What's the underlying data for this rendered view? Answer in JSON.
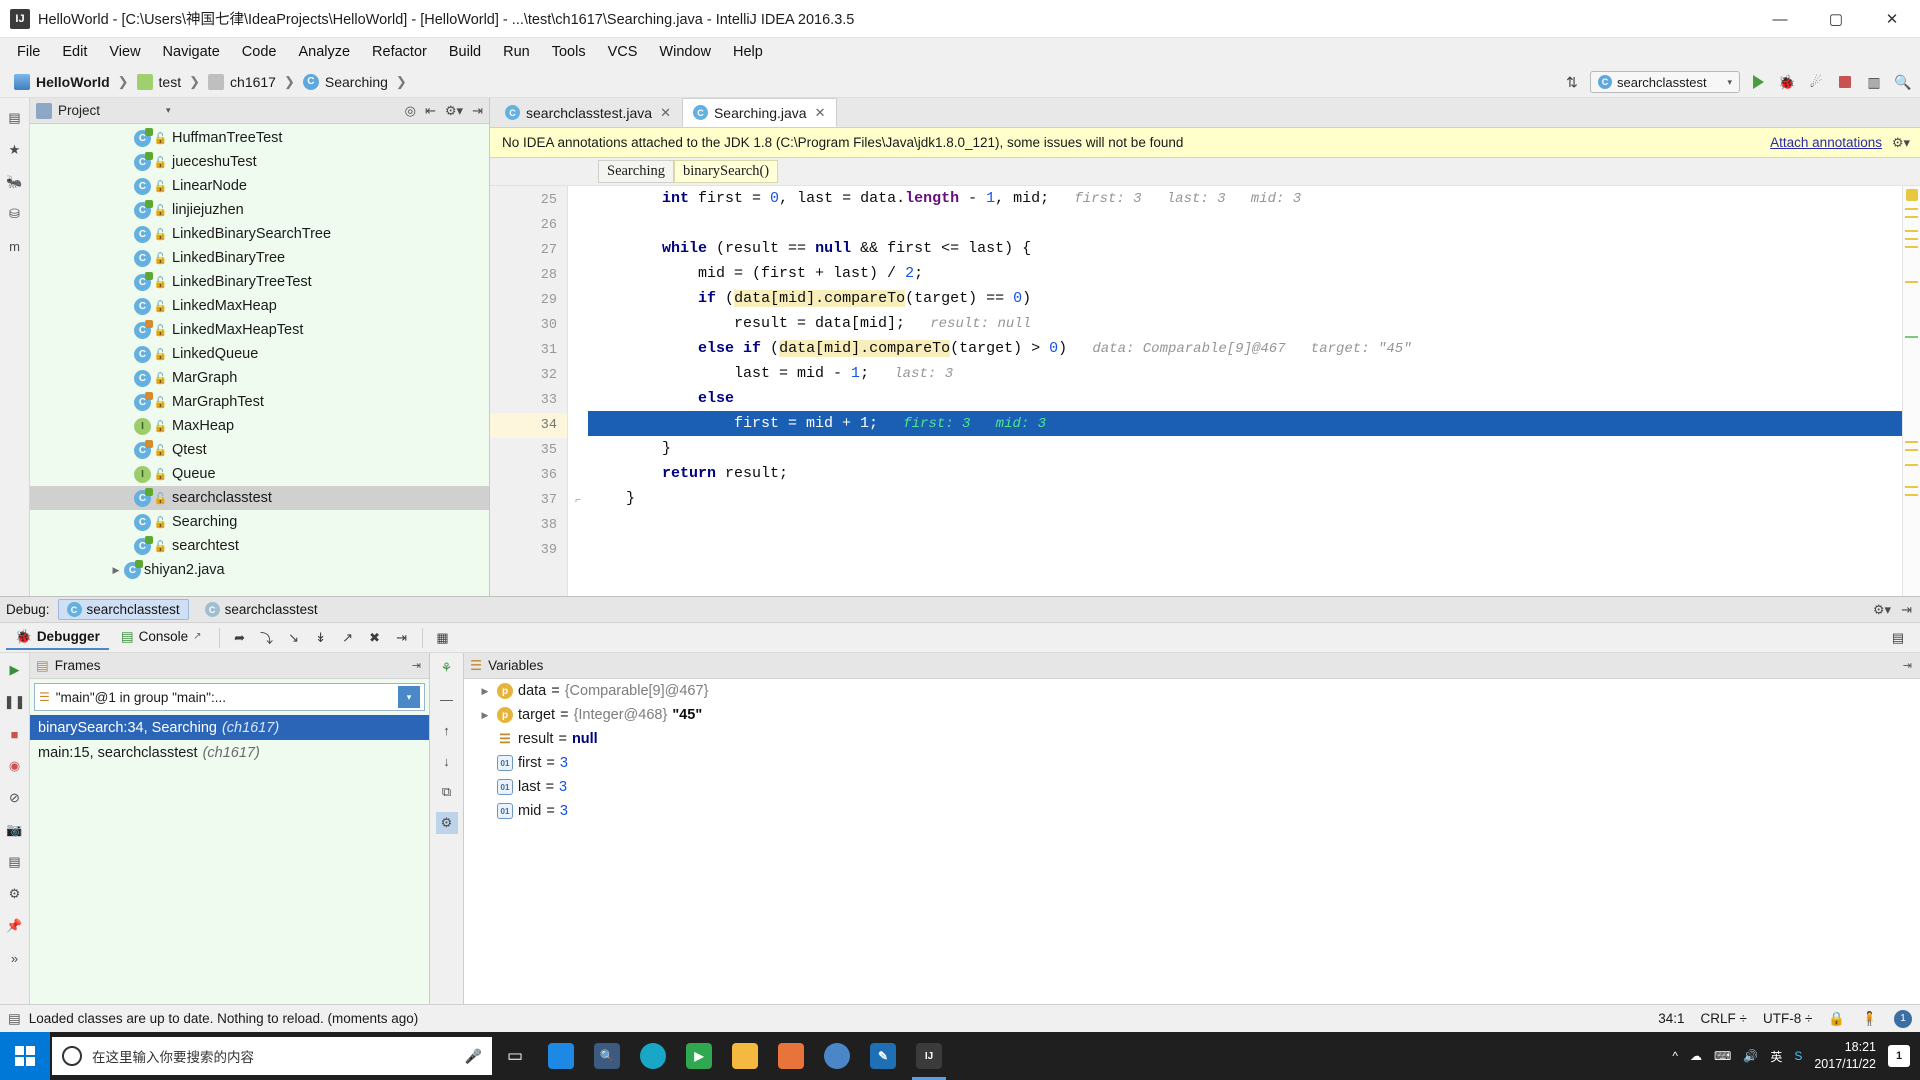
{
  "window": {
    "title": "HelloWorld - [C:\\Users\\神国七律\\IdeaProjects\\HelloWorld] - [HelloWorld] - ...\\test\\ch1617\\Searching.java - IntelliJ IDEA 2016.3.5",
    "app_icon": "IJ",
    "minimize": "—",
    "maximize": "▢",
    "close": "✕"
  },
  "menubar": {
    "items": [
      "File",
      "Edit",
      "View",
      "Navigate",
      "Code",
      "Analyze",
      "Refactor",
      "Build",
      "Run",
      "Tools",
      "VCS",
      "Window",
      "Help"
    ]
  },
  "navbar": {
    "crumbs": [
      {
        "label": "HelloWorld",
        "icon": "module-icon"
      },
      {
        "label": "test",
        "icon": "folder-icon"
      },
      {
        "label": "ch1617",
        "icon": "package-icon"
      },
      {
        "label": "Searching",
        "icon": "class-icon"
      }
    ],
    "separator": "❯",
    "run_config": "searchclasstest",
    "icons": {
      "sort": "⇅",
      "run": "run-icon",
      "debug": "🐞",
      "coverage": "coverage-icon",
      "stop": "stop-icon",
      "layout": "layout-icon",
      "search": "🔍"
    }
  },
  "left_strip": {
    "icons": [
      "structure-icon",
      "favorites-icon",
      "ant-build-icon",
      "database-icon",
      "maven-icon"
    ]
  },
  "project_panel": {
    "title": "Project",
    "caret": "▾",
    "header_icons": [
      "target-icon",
      "collapse-icon",
      "settings-icon",
      "hide-icon"
    ],
    "tree": [
      {
        "label": "HuffmanTreeTest",
        "kind": "class",
        "runnable": "green",
        "indent": 1
      },
      {
        "label": "jueceshuTest",
        "kind": "class",
        "runnable": "green",
        "indent": 1
      },
      {
        "label": "LinearNode",
        "kind": "class",
        "runnable": "none",
        "indent": 1
      },
      {
        "label": "linjiejuzhen",
        "kind": "class",
        "runnable": "green",
        "indent": 1
      },
      {
        "label": "LinkedBinarySearchTree",
        "kind": "class",
        "runnable": "none",
        "indent": 1
      },
      {
        "label": "LinkedBinaryTree",
        "kind": "class",
        "runnable": "none",
        "indent": 1
      },
      {
        "label": "LinkedBinaryTreeTest",
        "kind": "class",
        "runnable": "green",
        "indent": 1
      },
      {
        "label": "LinkedMaxHeap",
        "kind": "class",
        "runnable": "none",
        "indent": 1
      },
      {
        "label": "LinkedMaxHeapTest",
        "kind": "class",
        "runnable": "orange",
        "indent": 1
      },
      {
        "label": "LinkedQueue",
        "kind": "class",
        "runnable": "none",
        "indent": 1
      },
      {
        "label": "MarGraph",
        "kind": "class",
        "runnable": "none",
        "indent": 1
      },
      {
        "label": "MarGraphTest",
        "kind": "class",
        "runnable": "orange",
        "indent": 1
      },
      {
        "label": "MaxHeap",
        "kind": "interface",
        "runnable": "none",
        "indent": 1
      },
      {
        "label": "Qtest",
        "kind": "class",
        "runnable": "orange",
        "indent": 1
      },
      {
        "label": "Queue",
        "kind": "interface",
        "runnable": "none",
        "indent": 1
      },
      {
        "label": "searchclasstest",
        "kind": "class",
        "runnable": "green",
        "indent": 1,
        "selected": true
      },
      {
        "label": "Searching",
        "kind": "class",
        "runnable": "none",
        "indent": 1
      },
      {
        "label": "searchtest",
        "kind": "class",
        "runnable": "green",
        "indent": 1
      },
      {
        "label": "shiyan2.java",
        "kind": "class",
        "runnable": "green",
        "indent": 0,
        "twist": "▶"
      }
    ]
  },
  "editor": {
    "tabs": [
      {
        "label": "searchclasstest.java",
        "active": false,
        "close": "✕"
      },
      {
        "label": "Searching.java",
        "active": true,
        "close": "✕"
      }
    ],
    "notification": {
      "text": "No IDEA annotations attached to the JDK 1.8 (C:\\Program Files\\Java\\jdk1.8.0_121), some issues will not be found",
      "link": "Attach annotations",
      "gear": "⚙"
    },
    "breadcrumbs": [
      {
        "label": "Searching",
        "current": false
      },
      {
        "label": "binarySearch()",
        "current": true
      }
    ],
    "first_line_number": 25,
    "lines": [
      {
        "n": 25,
        "fold": "",
        "highlight": false,
        "segments": [
          {
            "t": "        ",
            "c": "plain"
          },
          {
            "t": "int",
            "c": "kw"
          },
          {
            "t": " first = ",
            "c": "plain"
          },
          {
            "t": "0",
            "c": "num"
          },
          {
            "t": ", last = data.",
            "c": "plain"
          },
          {
            "t": "length",
            "c": "fld"
          },
          {
            "t": " - ",
            "c": "plain"
          },
          {
            "t": "1",
            "c": "num"
          },
          {
            "t": ", mid;",
            "c": "plain"
          },
          {
            "t": "   first: 3   last: 3   mid: 3",
            "c": "hint"
          }
        ]
      },
      {
        "n": 26,
        "fold": "",
        "highlight": false,
        "segments": []
      },
      {
        "n": 27,
        "fold": "",
        "highlight": false,
        "segments": [
          {
            "t": "        ",
            "c": "plain"
          },
          {
            "t": "while",
            "c": "kw"
          },
          {
            "t": " (result == ",
            "c": "plain"
          },
          {
            "t": "null",
            "c": "kw"
          },
          {
            "t": " && first <= last) {",
            "c": "plain"
          }
        ]
      },
      {
        "n": 28,
        "fold": "",
        "highlight": false,
        "segments": [
          {
            "t": "            mid = (first + last) / ",
            "c": "plain"
          },
          {
            "t": "2",
            "c": "num"
          },
          {
            "t": ";",
            "c": "plain"
          }
        ]
      },
      {
        "n": 29,
        "fold": "",
        "highlight": false,
        "segments": [
          {
            "t": "            ",
            "c": "plain"
          },
          {
            "t": "if",
            "c": "kw"
          },
          {
            "t": " (",
            "c": "plain"
          },
          {
            "t": "data[mid].compareTo",
            "c": "mark"
          },
          {
            "t": "(target) == ",
            "c": "plain"
          },
          {
            "t": "0",
            "c": "num"
          },
          {
            "t": ")",
            "c": "plain"
          }
        ]
      },
      {
        "n": 30,
        "fold": "",
        "highlight": false,
        "segments": [
          {
            "t": "                result = data[mid];",
            "c": "plain"
          },
          {
            "t": "   result: null",
            "c": "hint"
          }
        ]
      },
      {
        "n": 31,
        "fold": "",
        "highlight": false,
        "segments": [
          {
            "t": "            ",
            "c": "plain"
          },
          {
            "t": "else if",
            "c": "kw"
          },
          {
            "t": " (",
            "c": "plain"
          },
          {
            "t": "data[mid].compareTo",
            "c": "mark"
          },
          {
            "t": "(target) > ",
            "c": "plain"
          },
          {
            "t": "0",
            "c": "num"
          },
          {
            "t": ")",
            "c": "plain"
          },
          {
            "t": "   data: Comparable[9]@467   target: \"45\"",
            "c": "hint"
          }
        ]
      },
      {
        "n": 32,
        "fold": "",
        "highlight": false,
        "segments": [
          {
            "t": "                last = mid - ",
            "c": "plain"
          },
          {
            "t": "1",
            "c": "num"
          },
          {
            "t": ";",
            "c": "plain"
          },
          {
            "t": "   last: 3",
            "c": "hint"
          }
        ]
      },
      {
        "n": 33,
        "fold": "",
        "highlight": false,
        "segments": [
          {
            "t": "            ",
            "c": "plain"
          },
          {
            "t": "else",
            "c": "kw"
          }
        ]
      },
      {
        "n": 34,
        "fold": "",
        "highlight": true,
        "segments": [
          {
            "t": "                first = mid + 1;",
            "c": "plain"
          },
          {
            "t": "   first: 3   mid: 3",
            "c": "hint-g"
          }
        ]
      },
      {
        "n": 35,
        "fold": "",
        "highlight": false,
        "segments": [
          {
            "t": "        }",
            "c": "plain"
          }
        ]
      },
      {
        "n": 36,
        "fold": "",
        "highlight": false,
        "segments": [
          {
            "t": "        ",
            "c": "plain"
          },
          {
            "t": "return",
            "c": "kw"
          },
          {
            "t": " result;",
            "c": "plain"
          }
        ]
      },
      {
        "n": 37,
        "fold": "⌐",
        "highlight": false,
        "segments": [
          {
            "t": "    }",
            "c": "plain"
          }
        ]
      },
      {
        "n": 38,
        "fold": "",
        "highlight": false,
        "segments": []
      },
      {
        "n": 39,
        "fold": "",
        "highlight": false,
        "segments": []
      }
    ]
  },
  "debug": {
    "label": "Debug:",
    "tabs": [
      {
        "label": "searchclasstest",
        "active": true
      },
      {
        "label": "searchclasstest",
        "active": false
      }
    ],
    "header_icons": [
      "settings-icon",
      "hide-icon"
    ],
    "sub_tabs": [
      {
        "label": "Debugger",
        "active": true
      },
      {
        "label": "Console",
        "active": false,
        "pin": "↗"
      }
    ],
    "tool_icons": [
      "mute-breakpoints-icon",
      "step-over-icon",
      "step-into-icon",
      "force-step-into-icon",
      "step-out-icon",
      "drop-frame-icon",
      "run-to-cursor-icon",
      "evaluate-icon"
    ],
    "restore_icon": "restore-layout-icon",
    "side_icons": [
      "resume-icon",
      "pause-icon",
      "stop-icon",
      "view-breakpoints-icon",
      "mute-breakpoints-icon",
      "settings-icon",
      "camera-icon",
      "layout-icon",
      "settings2-icon",
      "pin-icon",
      "more-icon"
    ],
    "frames": {
      "title": "Frames",
      "pin": "⇥",
      "thread": "\"main\"@1 in group \"main\":...",
      "thread_dropdown": "▾",
      "nav_icons": [
        "up-arrow-icon",
        "down-arrow-icon",
        "filter-icon"
      ],
      "toolbar_icons": [
        "show-frames-icon",
        "minus-icon",
        "up-icon",
        "down-icon",
        "copy-icon",
        "settings-icon"
      ],
      "rows": [
        {
          "method": "binarySearch:34, Searching",
          "pkg": "(ch1617)",
          "selected": true
        },
        {
          "method": "main:15, searchclasstest",
          "pkg": "(ch1617)",
          "selected": false
        }
      ]
    },
    "variables": {
      "title": "Variables",
      "icon": "variables-icon",
      "rows": [
        {
          "twist": "▶",
          "icon": "p",
          "name": "data",
          "eq": "=",
          "value": "{Comparable[9]@467}",
          "vclass": "obj"
        },
        {
          "twist": "▶",
          "icon": "p",
          "name": "target",
          "eq": "=",
          "value": "{Integer@468}",
          "value2": "\"45\"",
          "vclass": "obj"
        },
        {
          "twist": "",
          "icon": "res",
          "name": "result",
          "eq": "=",
          "value": "null",
          "vclass": "kw"
        },
        {
          "twist": "",
          "icon": "int",
          "name": "first",
          "eq": "=",
          "value": "3",
          "vclass": "num"
        },
        {
          "twist": "",
          "icon": "int",
          "name": "last",
          "eq": "=",
          "value": "3",
          "vclass": "num"
        },
        {
          "twist": "",
          "icon": "int",
          "name": "mid",
          "eq": "=",
          "value": "3",
          "vclass": "num"
        }
      ]
    }
  },
  "statusbar": {
    "icon": "event-log-icon",
    "message": "Loaded classes are up to date. Nothing to reload. (moments ago)",
    "caret_pos": "34:1",
    "line_sep": "CRLF ÷",
    "encoding": "UTF-8 ÷",
    "lock_icon": "🔒",
    "hector_icon": "hector-icon",
    "notification_count": "1"
  },
  "taskbar": {
    "search_placeholder": "在这里输入你要搜索的内容",
    "mic_icon": "🎤",
    "taskview_icon": "▭",
    "apps": [
      {
        "name": "app-blue",
        "color": "#1e88e5",
        "glyph": "",
        "active": false
      },
      {
        "name": "app-magnifier",
        "color": "#3d5a80",
        "glyph": "",
        "active": false
      },
      {
        "name": "app-teal",
        "color": "#19a7c8",
        "glyph": "",
        "active": false
      },
      {
        "name": "app-green",
        "color": "#2fa84f",
        "glyph": "▶",
        "active": false
      },
      {
        "name": "app-explorer",
        "color": "#f5b942",
        "glyph": "",
        "active": false
      },
      {
        "name": "app-orange",
        "color": "#e8743b",
        "glyph": "",
        "active": false
      },
      {
        "name": "app-browser",
        "color": "#4a86c8",
        "glyph": "",
        "active": false
      },
      {
        "name": "app-editor",
        "color": "#1f6fb5",
        "glyph": "✎",
        "active": false
      },
      {
        "name": "app-intellij",
        "color": "#3b3b3b",
        "glyph": "IJ",
        "active": true
      }
    ],
    "tray": [
      "^",
      "☁",
      "🔊",
      "⌨",
      "英",
      "S"
    ],
    "clock_time": "18:21",
    "clock_date": "2017/11/22",
    "notification_badge": "1"
  }
}
